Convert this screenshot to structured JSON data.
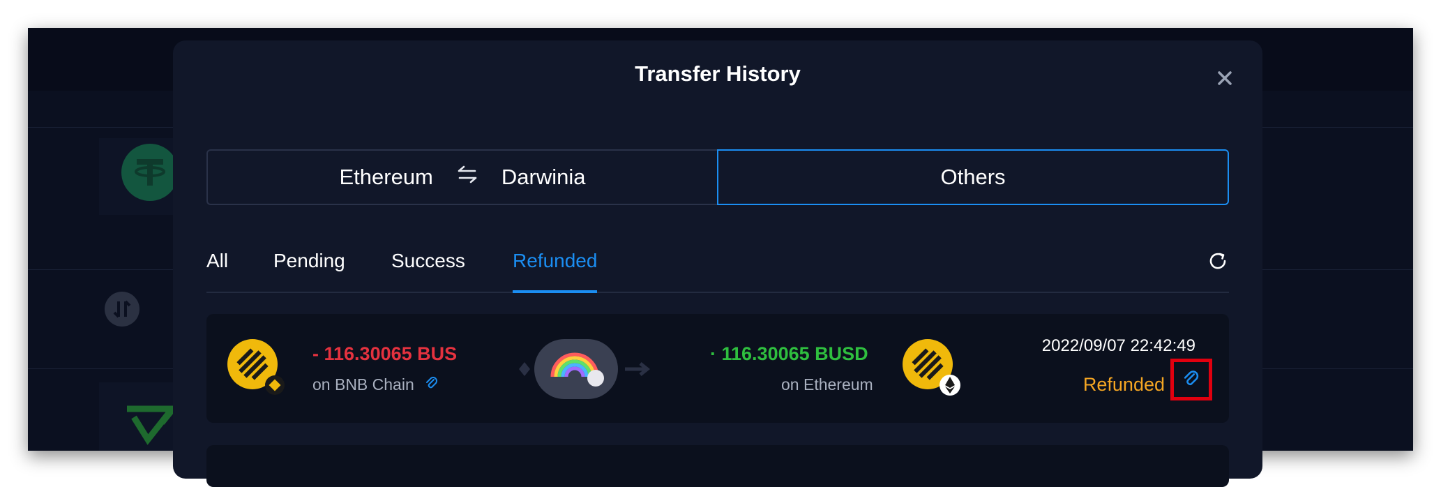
{
  "dialog": {
    "title": "Transfer History",
    "close_icon": "close-icon"
  },
  "network_switch": {
    "left_from": "Ethereum",
    "left_icon": "swap-arrows-icon",
    "left_to": "Darwinia",
    "right_label": "Others",
    "selected": "Others"
  },
  "filter_tabs": [
    {
      "label": "All"
    },
    {
      "label": "Pending"
    },
    {
      "label": "Success"
    },
    {
      "label": "Refunded"
    }
  ],
  "active_tab": "Refunded",
  "record": {
    "from_amount": "- 116.30065 BUS",
    "from_chain": "on BNB Chain",
    "to_amount": "· 116.30065 BUSD",
    "to_chain": "on Ethereum",
    "time": "2022/09/07 22:42:49",
    "status": "Refunded"
  },
  "colors": {
    "accent": "#1b8ef2",
    "negative": "#e5323f",
    "positive": "#2fbf3f",
    "refunded": "#f5a623",
    "highlight": "#e1000f",
    "busd": "#f0b90b"
  }
}
